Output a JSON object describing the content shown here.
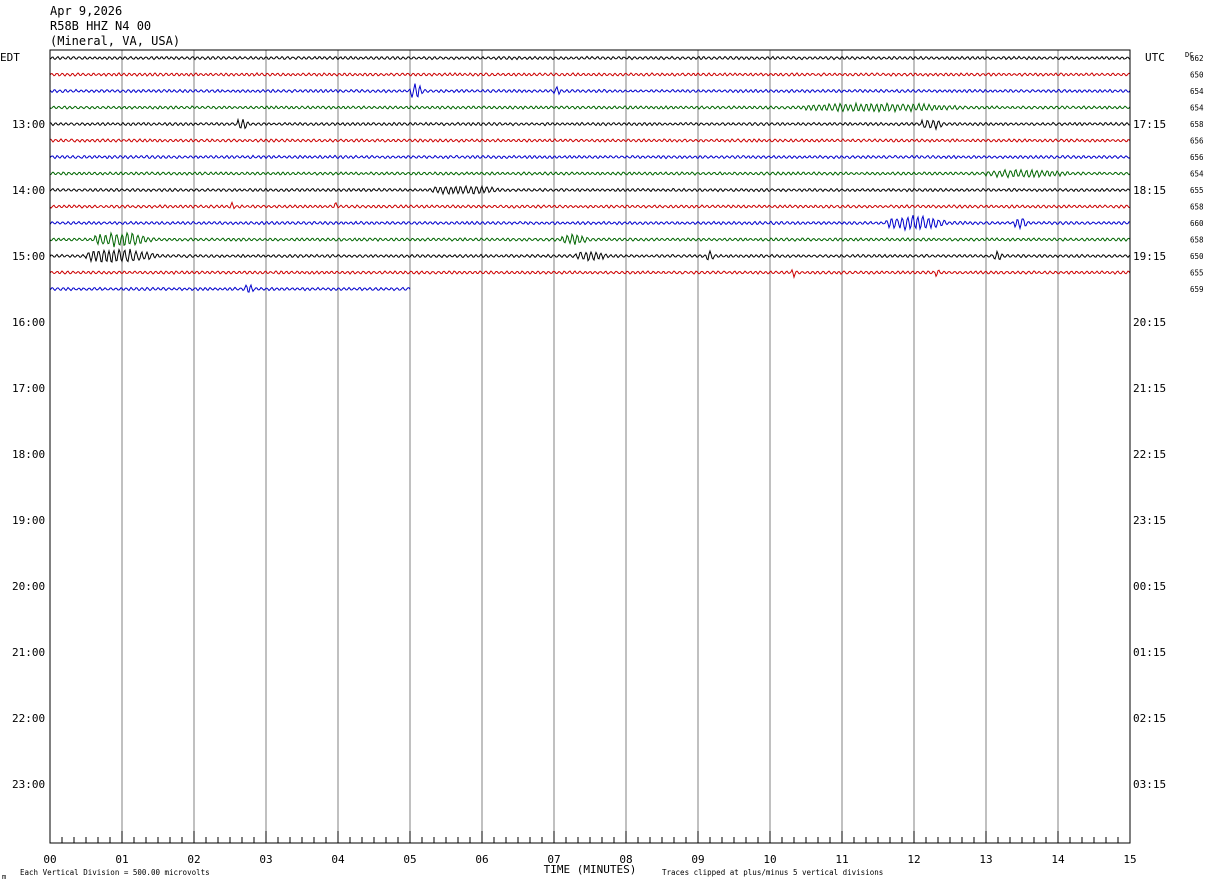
{
  "header": {
    "date": "Apr 9,2026",
    "station": "R58B HHZ N4 00",
    "location": "(Mineral, VA, USA)"
  },
  "left_tz": "EDT",
  "right_tz": "UTC",
  "dc_label": "DC",
  "footer": {
    "scale_note": "Each Vertical Division =  500.00 microvolts",
    "clip_note": "Traces clipped at plus/minus 5 vertical divisions",
    "corner_mark": "m"
  },
  "colors": {
    "black": "#000000",
    "red": "#cc0000",
    "blue": "#0000cc",
    "green": "#006600",
    "grid": "#808080"
  },
  "chart_data": {
    "type": "line",
    "chart_kind": "helicorder",
    "xlabel": "TIME (MINUTES)",
    "x_ticks": [
      "00",
      "01",
      "02",
      "03",
      "04",
      "05",
      "06",
      "07",
      "08",
      "09",
      "10",
      "11",
      "12",
      "13",
      "14",
      "15"
    ],
    "xlim": [
      0,
      15
    ],
    "left_hour_labels": [
      "13:00",
      "14:00",
      "15:00",
      "16:00",
      "17:00",
      "18:00",
      "19:00",
      "20:00",
      "21:00",
      "22:00",
      "23:00"
    ],
    "right_hour_labels": [
      "17:15",
      "18:15",
      "19:15",
      "20:15",
      "21:15",
      "22:15",
      "23:15",
      "00:15",
      "01:15",
      "02:15",
      "03:15"
    ],
    "lines_per_hour": 4,
    "total_lines": 48,
    "color_cycle": [
      "black",
      "red",
      "blue",
      "green"
    ],
    "dc_offsets": [
      "662",
      "650",
      "654",
      "654",
      "658",
      "656",
      "656",
      "654",
      "655",
      "658",
      "660",
      "658",
      "650",
      "655",
      "659"
    ],
    "traces": [
      {
        "color": "black",
        "events": []
      },
      {
        "color": "red",
        "events": []
      },
      {
        "color": "blue",
        "events": [
          {
            "start_min": 5.0,
            "dur_min": 0.3,
            "amp": 3.0
          },
          {
            "start_min": 7.0,
            "dur_min": 0.15,
            "amp": 1.6
          }
        ]
      },
      {
        "color": "green",
        "events": [
          {
            "start_min": 10.5,
            "dur_min": 3.5,
            "amp": 1.3
          }
        ]
      },
      {
        "color": "black",
        "events": [
          {
            "start_min": 2.6,
            "dur_min": 0.25,
            "amp": 2.0
          },
          {
            "start_min": 12.1,
            "dur_min": 0.5,
            "amp": 1.8
          }
        ]
      },
      {
        "color": "red",
        "events": []
      },
      {
        "color": "blue",
        "events": []
      },
      {
        "color": "green",
        "events": [
          {
            "start_min": 13.0,
            "dur_min": 1.8,
            "amp": 1.3
          }
        ]
      },
      {
        "color": "black",
        "events": [
          {
            "start_min": 5.3,
            "dur_min": 1.5,
            "amp": 1.4
          }
        ]
      },
      {
        "color": "red",
        "events": [
          {
            "start_min": 2.5,
            "dur_min": 0.1,
            "amp": 1.8
          },
          {
            "start_min": 3.95,
            "dur_min": 0.08,
            "amp": 1.8
          }
        ]
      },
      {
        "color": "blue",
        "events": [
          {
            "start_min": 11.6,
            "dur_min": 1.4,
            "amp": 2.6
          },
          {
            "start_min": 13.4,
            "dur_min": 0.3,
            "amp": 2.2
          }
        ]
      },
      {
        "color": "green",
        "events": [
          {
            "start_min": 0.6,
            "dur_min": 1.3,
            "amp": 2.6
          },
          {
            "start_min": 7.1,
            "dur_min": 0.6,
            "amp": 1.8
          }
        ]
      },
      {
        "color": "black",
        "events": [
          {
            "start_min": 0.5,
            "dur_min": 1.6,
            "amp": 2.6
          },
          {
            "start_min": 7.3,
            "dur_min": 0.7,
            "amp": 1.8
          },
          {
            "start_min": 9.1,
            "dur_min": 0.2,
            "amp": 1.6
          },
          {
            "start_min": 13.1,
            "dur_min": 0.2,
            "amp": 1.6
          }
        ]
      },
      {
        "color": "red",
        "events": [
          {
            "start_min": 10.3,
            "dur_min": 0.1,
            "amp": 1.8
          },
          {
            "start_min": 12.3,
            "dur_min": 0.1,
            "amp": 1.5
          }
        ]
      },
      {
        "color": "blue",
        "end_min": 5.0,
        "events": [
          {
            "start_min": 2.7,
            "dur_min": 0.2,
            "amp": 1.6
          }
        ]
      }
    ]
  }
}
